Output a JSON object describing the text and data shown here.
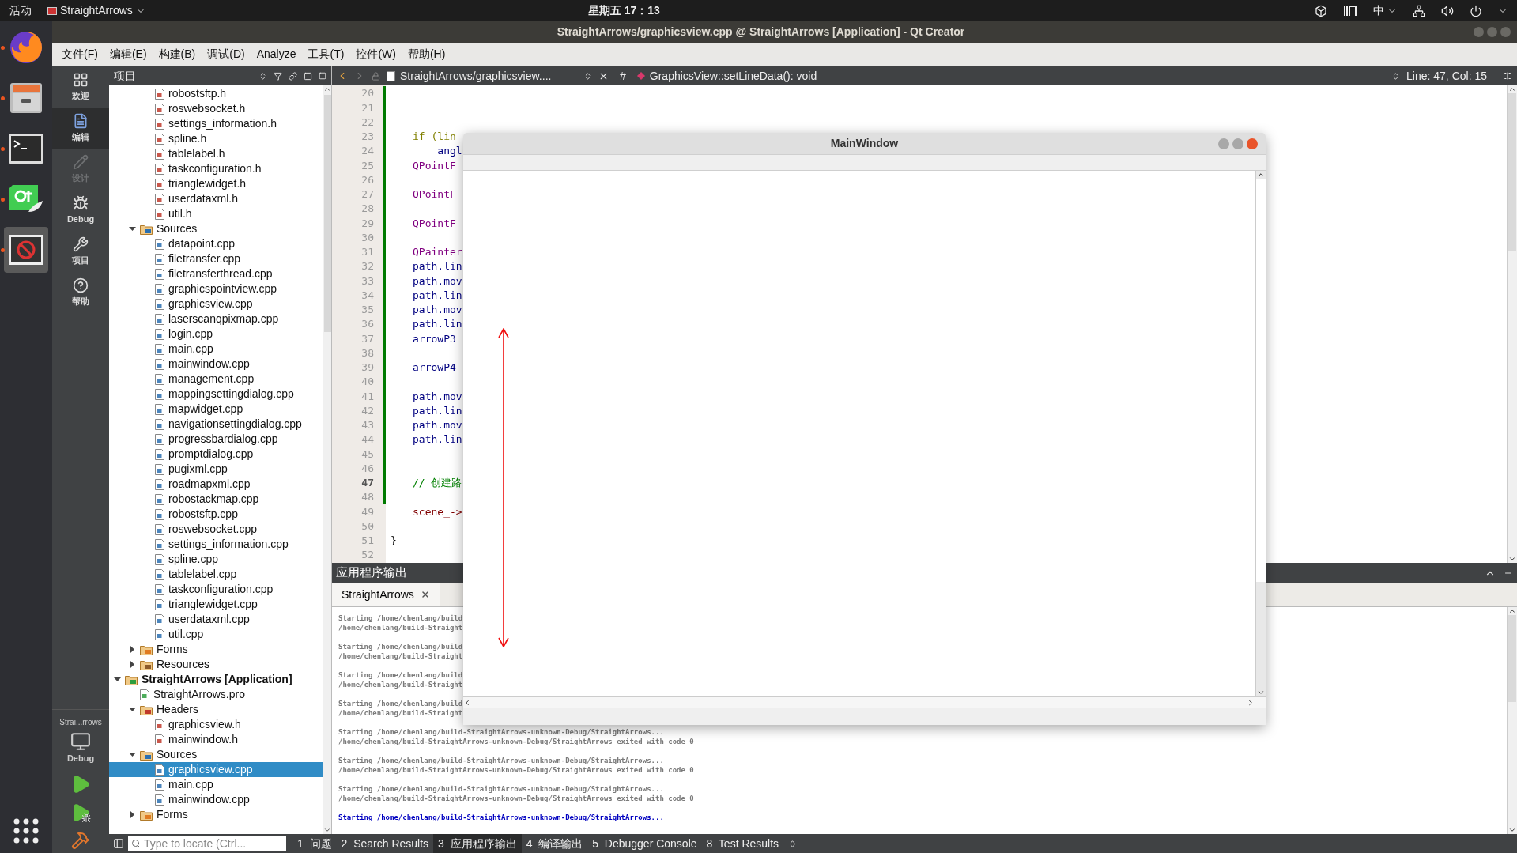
{
  "topbar": {
    "activities": "活动",
    "app_menu": "StraightArrows",
    "clock": "星期五 17：13",
    "input_method": "中"
  },
  "dock": [
    {
      "kind": "firefox",
      "running": true
    },
    {
      "kind": "files",
      "running": true
    },
    {
      "kind": "terminal",
      "running": true
    },
    {
      "kind": "qt",
      "running": true
    },
    {
      "kind": "app",
      "running": true
    }
  ],
  "window": {
    "title": "StraightArrows/graphicsview.cpp @ StraightArrows [Application] - Qt Creator"
  },
  "menu": [
    "文件(F)",
    "编辑(E)",
    "构建(B)",
    "调试(D)",
    "Analyze",
    "工具(T)",
    "控件(W)",
    "帮助(H)"
  ],
  "modes": [
    {
      "label": "欢迎",
      "kind": "welcome",
      "selected": false,
      "disabled": false
    },
    {
      "label": "编辑",
      "kind": "edit",
      "selected": true,
      "disabled": false
    },
    {
      "label": "设计",
      "kind": "design",
      "selected": false,
      "disabled": true
    },
    {
      "label": "Debug",
      "kind": "debug",
      "selected": false,
      "disabled": false
    },
    {
      "label": "项目",
      "kind": "projects",
      "selected": false,
      "disabled": false
    },
    {
      "label": "帮助",
      "kind": "help",
      "selected": false,
      "disabled": false
    }
  ],
  "kit": {
    "name": "Strai...rrows",
    "build": "Debug"
  },
  "project_panel": {
    "title": "项目"
  },
  "tree": [
    {
      "children": [
        {
          "children": [
            {
              "label": "robostsftp.h",
              "kind": "header",
              "selected": false
            },
            {
              "label": "roswebsocket.h",
              "kind": "header",
              "selected": false
            },
            {
              "label": "settings_information.h",
              "kind": "header",
              "selected": false
            },
            {
              "label": "spline.h",
              "kind": "header",
              "selected": false
            },
            {
              "label": "tablelabel.h",
              "kind": "header",
              "selected": false
            },
            {
              "label": "taskconfiguration.h",
              "kind": "header",
              "selected": false
            },
            {
              "label": "trianglewidget.h",
              "kind": "header",
              "selected": false
            },
            {
              "label": "userdataxml.h",
              "kind": "header",
              "selected": false
            },
            {
              "label": "util.h",
              "kind": "header",
              "selected": false
            }
          ]
        },
        {
          "label": "Sources",
          "kind": "sources",
          "expanded": true,
          "selected": false,
          "children": [
            {
              "label": "datapoint.cpp",
              "kind": "source",
              "selected": false
            },
            {
              "label": "filetransfer.cpp",
              "kind": "source",
              "selected": false
            },
            {
              "label": "filetransferthread.cpp",
              "kind": "source",
              "selected": false
            },
            {
              "label": "graphicspointview.cpp",
              "kind": "source",
              "selected": false
            },
            {
              "label": "graphicsview.cpp",
              "kind": "source",
              "selected": false
            },
            {
              "label": "laserscanqpixmap.cpp",
              "kind": "source",
              "selected": false
            },
            {
              "label": "login.cpp",
              "kind": "source",
              "selected": false
            },
            {
              "label": "main.cpp",
              "kind": "source",
              "selected": false
            },
            {
              "label": "mainwindow.cpp",
              "kind": "source",
              "selected": false
            },
            {
              "label": "management.cpp",
              "kind": "source",
              "selected": false
            },
            {
              "label": "mappingsettingdialog.cpp",
              "kind": "source",
              "selected": false
            },
            {
              "label": "mapwidget.cpp",
              "kind": "source",
              "selected": false
            },
            {
              "label": "navigationsettingdialog.cpp",
              "kind": "source",
              "selected": false
            },
            {
              "label": "progressbardialog.cpp",
              "kind": "source",
              "selected": false
            },
            {
              "label": "promptdialog.cpp",
              "kind": "source",
              "selected": false
            },
            {
              "label": "pugixml.cpp",
              "kind": "source",
              "selected": false
            },
            {
              "label": "roadmapxml.cpp",
              "kind": "source",
              "selected": false
            },
            {
              "label": "robostackmap.cpp",
              "kind": "source",
              "selected": false
            },
            {
              "label": "robostsftp.cpp",
              "kind": "source",
              "selected": false
            },
            {
              "label": "roswebsocket.cpp",
              "kind": "source",
              "selected": false
            },
            {
              "label": "settings_information.cpp",
              "kind": "source",
              "selected": false
            },
            {
              "label": "spline.cpp",
              "kind": "source",
              "selected": false
            },
            {
              "label": "tablelabel.cpp",
              "kind": "source",
              "selected": false
            },
            {
              "label": "taskconfiguration.cpp",
              "kind": "source",
              "selected": false
            },
            {
              "label": "trianglewidget.cpp",
              "kind": "source",
              "selected": false
            },
            {
              "label": "userdataxml.cpp",
              "kind": "source",
              "selected": false
            },
            {
              "label": "util.cpp",
              "kind": "source",
              "selected": false
            }
          ]
        },
        {
          "label": "Forms",
          "kind": "forms",
          "expanded": false,
          "selected": false
        },
        {
          "label": "Resources",
          "kind": "resources",
          "expanded": false,
          "selected": false
        }
      ]
    },
    {
      "label": "StraightArrows [Application]",
      "kind": "project",
      "expanded": true,
      "selected": false,
      "children": [
        {
          "label": "StraightArrows.pro",
          "kind": "pro",
          "selected": false
        },
        {
          "label": "Headers",
          "kind": "headers",
          "expanded": true,
          "selected": false,
          "children": [
            {
              "label": "graphicsview.h",
              "kind": "header",
              "selected": false
            },
            {
              "label": "mainwindow.h",
              "kind": "header",
              "selected": false
            }
          ]
        },
        {
          "label": "Sources",
          "kind": "sources",
          "expanded": true,
          "selected": false,
          "children": [
            {
              "label": "graphicsview.cpp",
              "kind": "source",
              "selected": true
            },
            {
              "label": "main.cpp",
              "kind": "source",
              "selected": false
            },
            {
              "label": "mainwindow.cpp",
              "kind": "source",
              "selected": false
            }
          ]
        },
        {
          "label": "Forms",
          "kind": "forms",
          "expanded": false,
          "selected": false
        }
      ]
    }
  ],
  "editor": {
    "file": "StraightArrows/graphicsview....",
    "symbol": "GraphicsView::setLineData(): void",
    "hash": "#",
    "position": "Line: 47, Col: 15",
    "lines": [
      {
        "number": "20",
        "kind": "plain",
        "current": false
      },
      {
        "number": "21",
        "kind": "plain",
        "current": false
      },
      {
        "number": "22",
        "kind": "plain",
        "current": false
      },
      {
        "number": "23",
        "code": "if (lin",
        "kind": "keyword",
        "current": false
      },
      {
        "number": "24",
        "code": "    angl",
        "kind": "plain",
        "current": false
      },
      {
        "number": "25",
        "code": "QPointF",
        "kind": "type",
        "current": false
      },
      {
        "number": "26",
        "kind": "plain",
        "current": false
      },
      {
        "number": "27",
        "code": "QPointF",
        "kind": "type",
        "current": false
      },
      {
        "number": "28",
        "kind": "plain",
        "current": false
      },
      {
        "number": "29",
        "code": "QPointF",
        "kind": "type",
        "current": false
      },
      {
        "number": "30",
        "kind": "plain",
        "current": false
      },
      {
        "number": "31",
        "code": "QPainter",
        "kind": "type",
        "current": false
      },
      {
        "number": "32",
        "code": "path.lin",
        "kind": "plain",
        "current": false
      },
      {
        "number": "33",
        "code": "path.mov",
        "kind": "plain",
        "current": false
      },
      {
        "number": "34",
        "code": "path.lin",
        "kind": "plain",
        "current": false
      },
      {
        "number": "35",
        "code": "path.mov",
        "kind": "plain",
        "current": false
      },
      {
        "number": "36",
        "code": "path.lin",
        "kind": "plain",
        "current": false
      },
      {
        "number": "37",
        "code": "arrowP3",
        "kind": "plain",
        "current": false
      },
      {
        "number": "38",
        "kind": "plain",
        "current": false
      },
      {
        "number": "39",
        "code": "arrowP4",
        "kind": "plain",
        "current": false
      },
      {
        "number": "40",
        "kind": "plain",
        "current": false
      },
      {
        "number": "41",
        "code": "path.mov",
        "kind": "plain",
        "current": false
      },
      {
        "number": "42",
        "code": "path.lin",
        "kind": "plain",
        "current": false
      },
      {
        "number": "43",
        "code": "path.mov",
        "kind": "plain",
        "current": false
      },
      {
        "number": "44",
        "code": "path.lin",
        "kind": "plain",
        "current": false
      },
      {
        "number": "45",
        "kind": "plain",
        "current": false
      },
      {
        "number": "46",
        "kind": "plain",
        "current": false
      },
      {
        "number": "47",
        "code": "// 创建路",
        "kind": "comment",
        "current": true
      },
      {
        "number": "48",
        "kind": "plain",
        "current": false
      },
      {
        "number": "49",
        "code": "scene_->",
        "kind": "member",
        "current": false
      },
      {
        "number": "50",
        "kind": "plain",
        "current": false
      },
      {
        "number": "51",
        "code": "}",
        "kind": "brace",
        "current": false
      },
      {
        "number": "52",
        "kind": "plain",
        "current": false
      }
    ]
  },
  "output": {
    "title": "应用程序输出",
    "tab": {
      "label": "StraightArrows",
      "selected": true
    },
    "lines": [
      {
        "text": "Starting /home/chenlang/build",
        "kind": "start"
      },
      {
        "text": "/home/chenlang/build-Straight",
        "kind": "exit"
      },
      {
        "text": "Starting /home/chenlang/build",
        "kind": "start"
      },
      {
        "text": "/home/chenlang/build-Straight",
        "kind": "exit"
      },
      {
        "text": "Starting /home/chenlang/build",
        "kind": "start"
      },
      {
        "text": "/home/chenlang/build-Straight",
        "kind": "exit"
      },
      {
        "text": "Starting /home/chenlang/build",
        "kind": "start"
      },
      {
        "text": "/home/chenlang/build-Straight",
        "kind": "exit"
      },
      {
        "text": "Starting /home/chenlang/build-StraightArrows-unknown-Debug/StraightArrows...",
        "kind": "start"
      },
      {
        "text": "/home/chenlang/build-StraightArrows-unknown-Debug/StraightArrows exited with code 0",
        "kind": "exit"
      },
      {
        "text": "Starting /home/chenlang/build-StraightArrows-unknown-Debug/StraightArrows...",
        "kind": "start"
      },
      {
        "text": "/home/chenlang/build-StraightArrows-unknown-Debug/StraightArrows exited with code 0",
        "kind": "exit"
      },
      {
        "text": "Starting /home/chenlang/build-StraightArrows-unknown-Debug/StraightArrows...",
        "kind": "start"
      },
      {
        "text": "/home/chenlang/build-StraightArrows-unknown-Debug/StraightArrows exited with code 0",
        "kind": "exit"
      },
      {
        "text": "Starting /home/chenlang/build-StraightArrows-unknown-Debug/StraightArrows...",
        "kind": "running"
      }
    ]
  },
  "statusbar": {
    "locate": {
      "placeholder": "Type to locate (Ctrl..."
    },
    "panes": [
      {
        "label": "1  问题",
        "selected": false
      },
      {
        "label": "2  Search Results",
        "selected": false
      },
      {
        "label": "3  应用程序输出",
        "selected": true
      },
      {
        "label": "4  编译输出",
        "selected": false
      },
      {
        "label": "5  Debugger Console",
        "selected": false
      },
      {
        "label": "8  Test Results",
        "selected": false
      }
    ]
  },
  "app_window": {
    "title": "MainWindow"
  }
}
